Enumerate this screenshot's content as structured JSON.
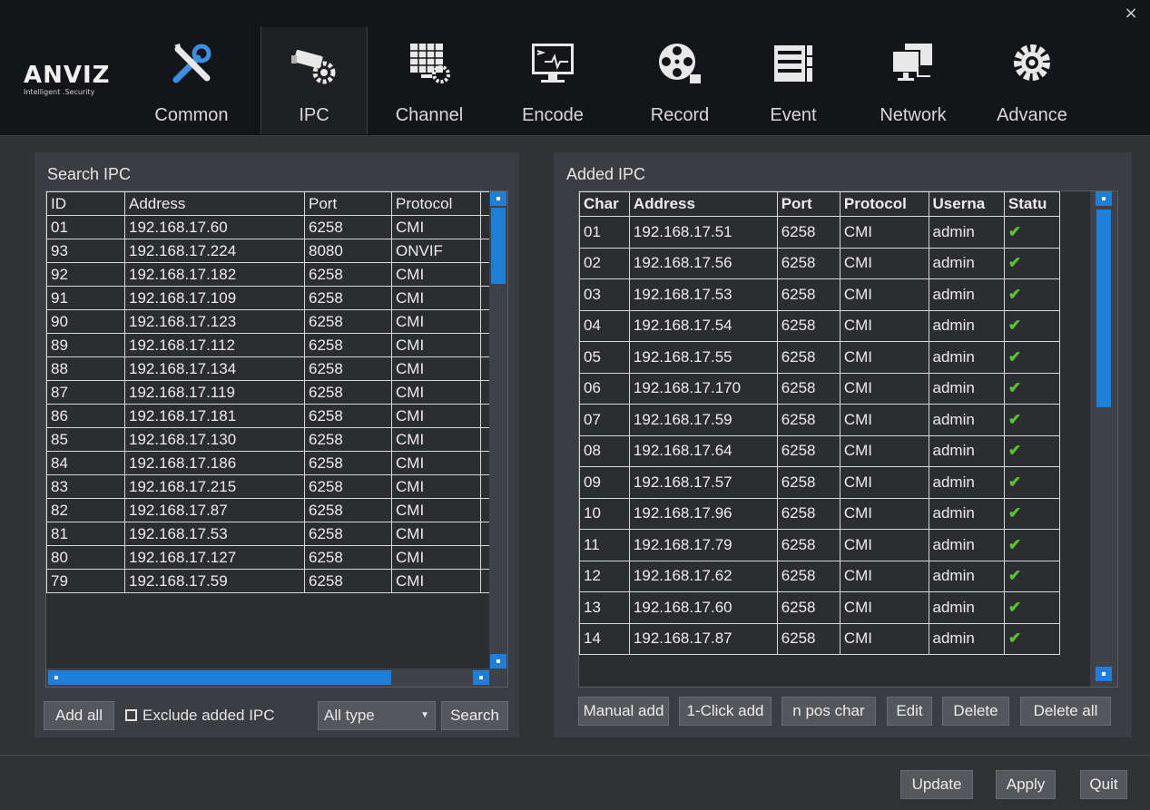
{
  "brand": {
    "name": "ANVIZ",
    "tagline": "Intelligent .Security"
  },
  "nav": [
    {
      "label": "Common",
      "icon": "tools-icon"
    },
    {
      "label": "IPC",
      "icon": "camera-gear-icon",
      "active": true
    },
    {
      "label": "Channel",
      "icon": "channel-grid-icon"
    },
    {
      "label": "Encode",
      "icon": "encode-monitor-icon"
    },
    {
      "label": "Record",
      "icon": "film-reel-icon"
    },
    {
      "label": "Event",
      "icon": "event-list-icon"
    },
    {
      "label": "Network",
      "icon": "network-icon"
    },
    {
      "label": "Advance",
      "icon": "advance-gear-icon"
    }
  ],
  "close_label": "×",
  "search_panel": {
    "title": "Search IPC",
    "columns": [
      "ID",
      "Address",
      "Port",
      "Protocol"
    ],
    "rows": [
      [
        "01",
        "192.168.17.60",
        "6258",
        "CMI"
      ],
      [
        "93",
        "192.168.17.224",
        "8080",
        "ONVIF"
      ],
      [
        "92",
        "192.168.17.182",
        "6258",
        "CMI"
      ],
      [
        "91",
        "192.168.17.109",
        "6258",
        "CMI"
      ],
      [
        "90",
        "192.168.17.123",
        "6258",
        "CMI"
      ],
      [
        "89",
        "192.168.17.112",
        "6258",
        "CMI"
      ],
      [
        "88",
        "192.168.17.134",
        "6258",
        "CMI"
      ],
      [
        "87",
        "192.168.17.119",
        "6258",
        "CMI"
      ],
      [
        "86",
        "192.168.17.181",
        "6258",
        "CMI"
      ],
      [
        "85",
        "192.168.17.130",
        "6258",
        "CMI"
      ],
      [
        "84",
        "192.168.17.186",
        "6258",
        "CMI"
      ],
      [
        "83",
        "192.168.17.215",
        "6258",
        "CMI"
      ],
      [
        "82",
        "192.168.17.87",
        "6258",
        "CMI"
      ],
      [
        "81",
        "192.168.17.53",
        "6258",
        "CMI"
      ],
      [
        "80",
        "192.168.17.127",
        "6258",
        "CMI"
      ],
      [
        "79",
        "192.168.17.59",
        "6258",
        "CMI"
      ]
    ],
    "add_all": "Add all",
    "exclude_label": "Exclude added IPC",
    "exclude_checked": false,
    "type_select": "All type",
    "search_button": "Search"
  },
  "added_panel": {
    "title": "Added IPC",
    "columns": [
      "Char",
      "Address",
      "Port",
      "Protocol",
      "Userna",
      "Statu"
    ],
    "rows": [
      [
        "01",
        "192.168.17.51",
        "6258",
        "CMI",
        "admin"
      ],
      [
        "02",
        "192.168.17.56",
        "6258",
        "CMI",
        "admin"
      ],
      [
        "03",
        "192.168.17.53",
        "6258",
        "CMI",
        "admin"
      ],
      [
        "04",
        "192.168.17.54",
        "6258",
        "CMI",
        "admin"
      ],
      [
        "05",
        "192.168.17.55",
        "6258",
        "CMI",
        "admin"
      ],
      [
        "06",
        "192.168.17.170",
        "6258",
        "CMI",
        "admin"
      ],
      [
        "07",
        "192.168.17.59",
        "6258",
        "CMI",
        "admin"
      ],
      [
        "08",
        "192.168.17.64",
        "6258",
        "CMI",
        "admin"
      ],
      [
        "09",
        "192.168.17.57",
        "6258",
        "CMI",
        "admin"
      ],
      [
        "10",
        "192.168.17.96",
        "6258",
        "CMI",
        "admin"
      ],
      [
        "11",
        "192.168.17.79",
        "6258",
        "CMI",
        "admin"
      ],
      [
        "12",
        "192.168.17.62",
        "6258",
        "CMI",
        "admin"
      ],
      [
        "13",
        "192.168.17.60",
        "6258",
        "CMI",
        "admin"
      ],
      [
        "14",
        "192.168.17.87",
        "6258",
        "CMI",
        "admin"
      ]
    ],
    "status_glyph": "✔",
    "buttons": {
      "manual_add": "Manual add",
      "one_click_add": "1-Click add",
      "pos_change": "n pos char",
      "edit": "Edit",
      "delete": "Delete",
      "delete_all": "Delete all"
    }
  },
  "footer": {
    "update": "Update",
    "apply": "Apply",
    "quit": "Quit"
  },
  "colors": {
    "accent": "#1d7fd8",
    "status_ok": "#5cc233",
    "header_bg": "#141518",
    "panel_bg": "#3b3d42"
  }
}
